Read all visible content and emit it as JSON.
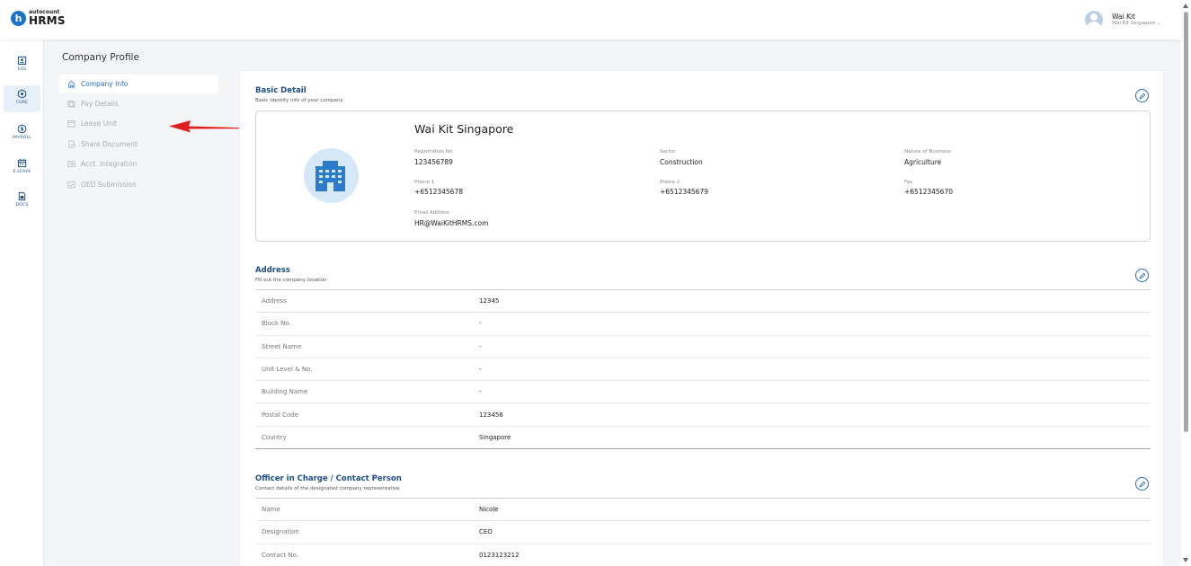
{
  "app": {
    "logo_small": "autocount",
    "logo_big": "HRMS",
    "logo_letter": "h"
  },
  "user": {
    "name": "Wai Kit",
    "company": "Wai Kit Singapore ⌄"
  },
  "rail": [
    {
      "label": "ESS",
      "icon": "ess-icon"
    },
    {
      "label": "CORE",
      "icon": "core-icon"
    },
    {
      "label": "PAYROLL",
      "icon": "payroll-icon"
    },
    {
      "label": "E-LEAVE",
      "icon": "eleave-icon"
    },
    {
      "label": "DOCS",
      "icon": "docs-icon"
    }
  ],
  "page_title": "Company Profile",
  "subnav": [
    {
      "label": "Company Info",
      "icon": "company-icon"
    },
    {
      "label": "Pay Details",
      "icon": "pay-icon"
    },
    {
      "label": "Leave Unit",
      "icon": "leave-icon"
    },
    {
      "label": "Share Document",
      "icon": "share-icon"
    },
    {
      "label": "Acct. Integration",
      "icon": "integration-icon"
    },
    {
      "label": "OED Submission",
      "icon": "submission-icon"
    }
  ],
  "basic": {
    "title": "Basic Detail",
    "subtitle": "Basic identity info of your company",
    "company_name": "Wai Kit Singapore",
    "fields": {
      "registration_label": "Registration No",
      "registration_value": "123456789",
      "sector_label": "Sector",
      "sector_value": "Construction",
      "nature_label": "Nature of Business",
      "nature_value": "Agriculture",
      "phone1_label": "Phone 1",
      "phone1_value": "+6512345678",
      "phone2_label": "Phone 2",
      "phone2_value": "+6512345679",
      "fax_label": "Fax",
      "fax_value": "+6512345670",
      "email_label": "Email Address",
      "email_value": "HR@WaiKitHRMS.com"
    }
  },
  "address": {
    "title": "Address",
    "subtitle": "Fill out the company location",
    "rows": [
      {
        "k": "Address",
        "v": "12345"
      },
      {
        "k": "Block No.",
        "v": "-"
      },
      {
        "k": "Street Name",
        "v": "-"
      },
      {
        "k": "Unit Level & No.",
        "v": "-"
      },
      {
        "k": "Building Name",
        "v": "-"
      },
      {
        "k": "Postal Code",
        "v": "123456"
      },
      {
        "k": "Country",
        "v": "Singapore"
      }
    ]
  },
  "officer": {
    "title": "Officer in Charge / Contact Person",
    "subtitle": "Contact details of the designated company representative",
    "rows": [
      {
        "k": "Name",
        "v": "Nicole"
      },
      {
        "k": "Designation",
        "v": "CEO"
      },
      {
        "k": "Contact No.",
        "v": "0123123212"
      }
    ]
  },
  "colors": {
    "accent": "#2d6cb5",
    "section_title": "#1e4f8a",
    "annotation_arrow": "#e02020"
  }
}
